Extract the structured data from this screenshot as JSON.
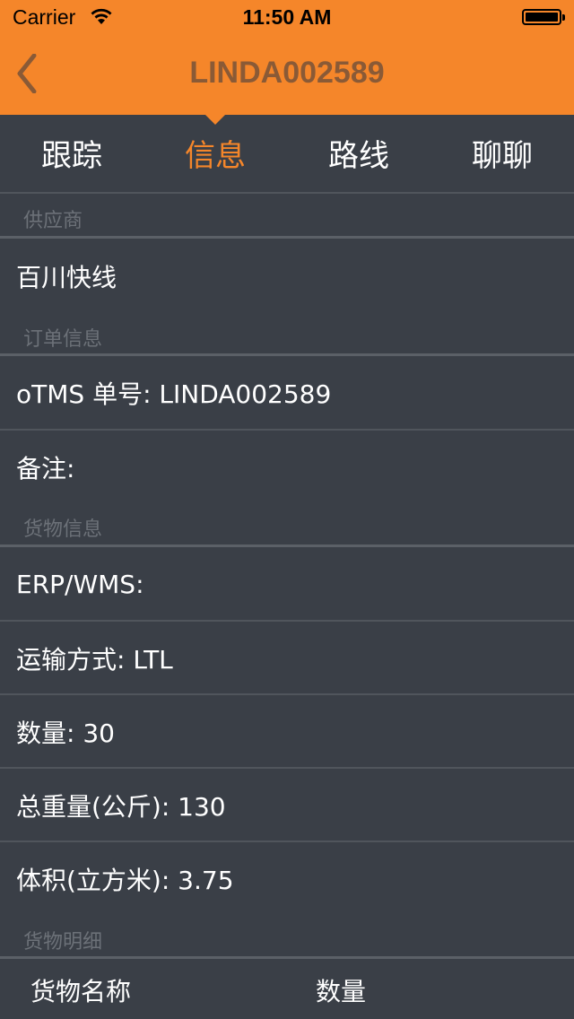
{
  "status_bar": {
    "carrier": "Carrier",
    "time": "11:50 AM"
  },
  "nav": {
    "title": "LINDA002589",
    "back_icon": "chevron-left-icon"
  },
  "tabs": [
    {
      "label": "跟踪",
      "active": false
    },
    {
      "label": "信息",
      "active": true
    },
    {
      "label": "路线",
      "active": false
    },
    {
      "label": "聊聊",
      "active": false
    }
  ],
  "sections": {
    "supplier": {
      "header": "供应商",
      "value": "百川快线"
    },
    "order": {
      "header": "订单信息",
      "otms_no": "oTMS 单号: LINDA002589",
      "remark": "备注:"
    },
    "cargo": {
      "header": "货物信息",
      "erp_wms": "ERP/WMS:",
      "transport": "运输方式: LTL",
      "quantity": "数量: 30",
      "weight": "总重量(公斤): 130",
      "volume": "体积(立方米): 3.75"
    },
    "cargo_detail": {
      "header": "货物明细",
      "col_name": "货物名称",
      "col_qty": "数量"
    }
  },
  "colors": {
    "accent": "#f5862a",
    "background": "#3a3f47",
    "title_text": "#8a5a36"
  }
}
